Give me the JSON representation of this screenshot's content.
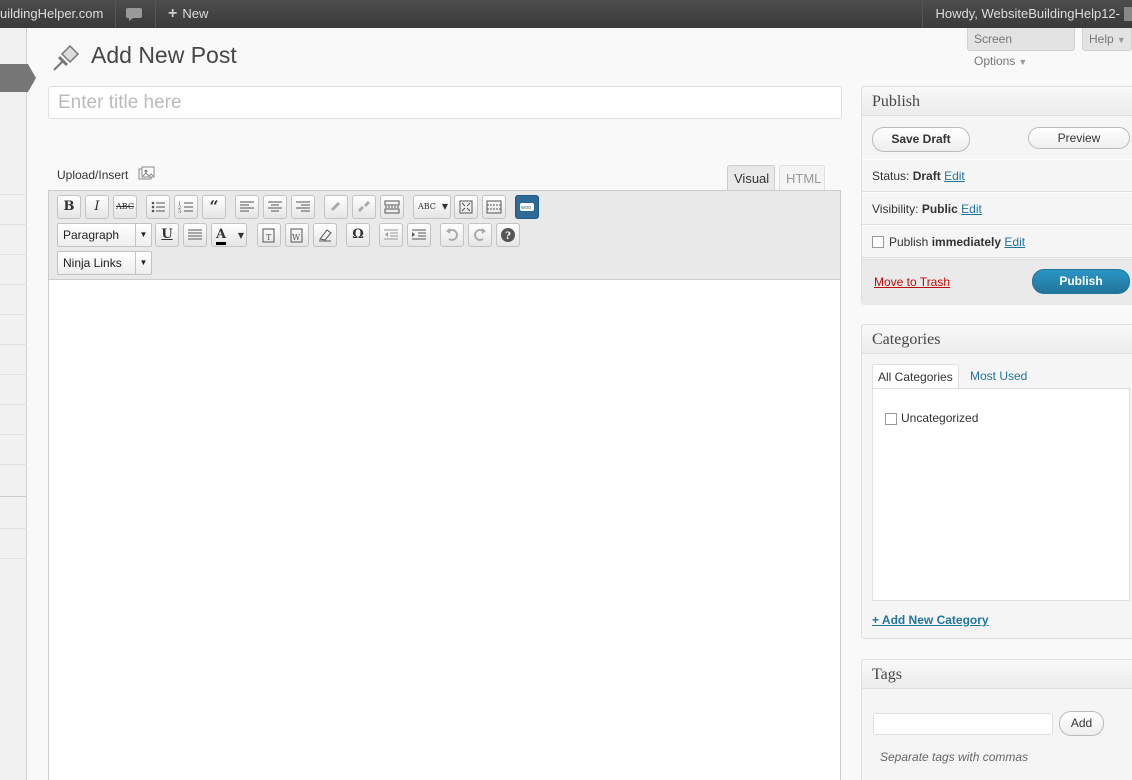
{
  "admin_bar": {
    "site_name": "uildingHelper.com",
    "new_label": "New",
    "howdy": "Howdy, WebsiteBuildingHelp12-"
  },
  "screen_meta": {
    "screen_options": "Screen Options",
    "help": "Help"
  },
  "page": {
    "title": "Add New Post",
    "title_placeholder": "Enter title here"
  },
  "editor": {
    "upload_insert": "Upload/Insert",
    "tabs": {
      "visual": "Visual",
      "html": "HTML"
    },
    "format_select": "Paragraph",
    "ninja_select": "Ninja Links",
    "toolbar_icons": [
      "bold-icon",
      "italic-icon",
      "strikethrough-icon",
      "bullet-list-icon",
      "numbered-list-icon",
      "blockquote-icon",
      "align-left-icon",
      "align-center-icon",
      "align-right-icon",
      "link-icon",
      "unlink-icon",
      "more-tag-icon",
      "spellcheck-icon",
      "fullscreen-icon",
      "kitchen-sink-icon",
      "woo-icon",
      "underline-icon",
      "justify-icon",
      "text-color-icon",
      "paste-text-icon",
      "paste-word-icon",
      "clear-format-icon",
      "special-char-icon",
      "outdent-icon",
      "indent-icon",
      "undo-icon",
      "redo-icon",
      "help-icon"
    ]
  },
  "publish": {
    "heading": "Publish",
    "save_draft": "Save Draft",
    "preview": "Preview",
    "status_label": "Status:",
    "status_value": "Draft",
    "visibility_label": "Visibility:",
    "visibility_value": "Public",
    "publish_label": "Publish",
    "publish_value": "immediately",
    "edit": "Edit",
    "trash": "Move to Trash",
    "publish_button": "Publish"
  },
  "categories": {
    "heading": "Categories",
    "tab_all": "All Categories",
    "tab_used": "Most Used",
    "items": [
      "Uncategorized"
    ],
    "add_new": "+ Add New Category"
  },
  "tags": {
    "heading": "Tags",
    "add": "Add",
    "hint": "Separate tags with commas"
  },
  "colors": {
    "admin_bar": "#464646",
    "link": "#21759b",
    "publish_button": "#21759b",
    "trash": "#bc0b0b"
  }
}
